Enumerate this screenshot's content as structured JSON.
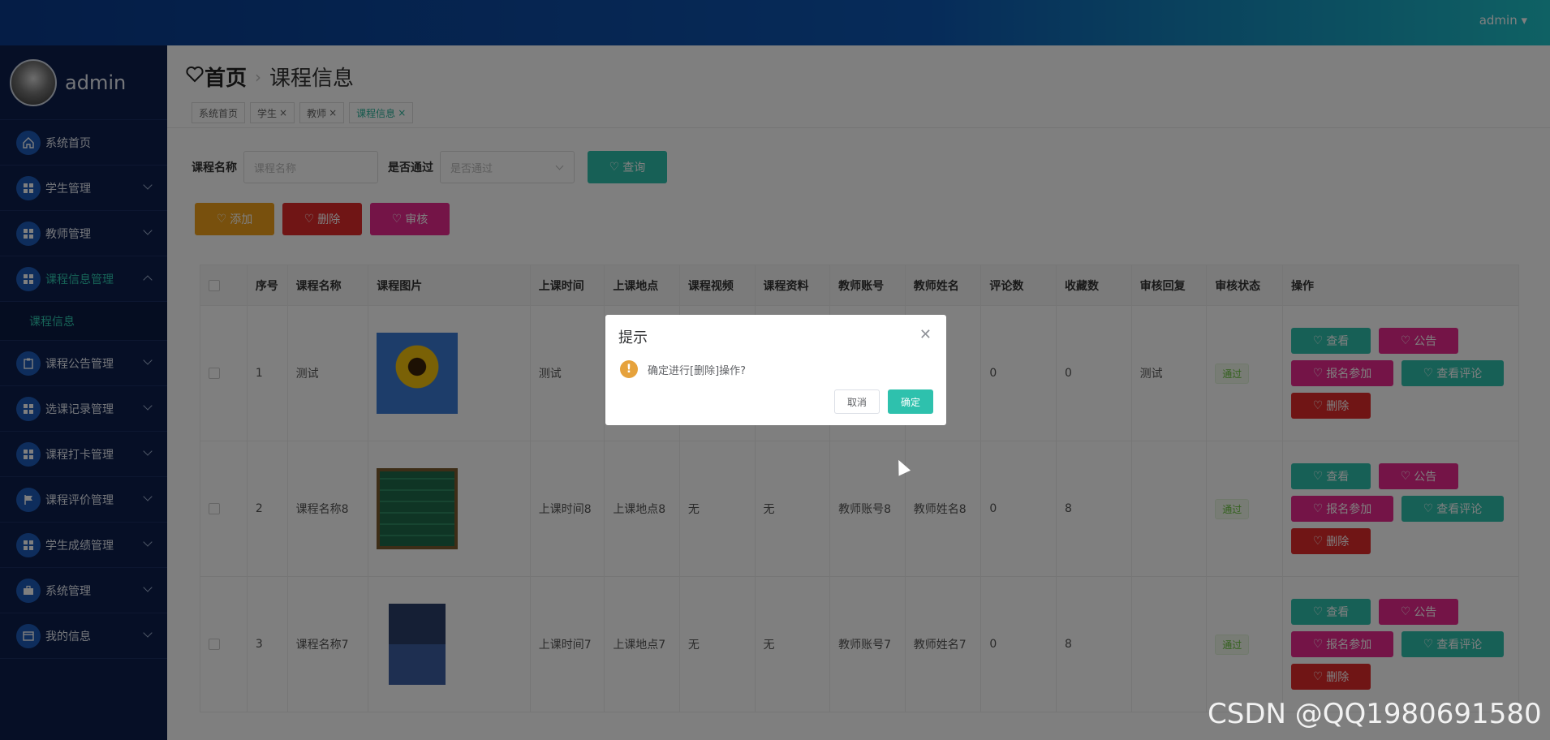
{
  "topbar": {
    "user": "admin ▾"
  },
  "sidebar": {
    "profile_name": "admin",
    "items": [
      {
        "label": "系统首页",
        "icon": "home-icon"
      },
      {
        "label": "学生管理",
        "icon": "grid-icon"
      },
      {
        "label": "教师管理",
        "icon": "grid-icon"
      },
      {
        "label": "课程信息管理",
        "icon": "grid-icon"
      },
      {
        "label": "课程公告管理",
        "icon": "clipboard-icon"
      },
      {
        "label": "选课记录管理",
        "icon": "grid-icon"
      },
      {
        "label": "课程打卡管理",
        "icon": "grid-icon"
      },
      {
        "label": "课程评价管理",
        "icon": "flag-icon"
      },
      {
        "label": "学生成绩管理",
        "icon": "grid-icon"
      },
      {
        "label": "系统管理",
        "icon": "briefcase-icon"
      },
      {
        "label": "我的信息",
        "icon": "card-icon"
      }
    ],
    "submenu": "课程信息"
  },
  "breadcrumb": {
    "home": "首页",
    "current": "课程信息"
  },
  "tabs": [
    {
      "label": "系统首页",
      "closable": false
    },
    {
      "label": "学生",
      "closable": true
    },
    {
      "label": "教师",
      "closable": true
    },
    {
      "label": "课程信息",
      "closable": true
    }
  ],
  "search": {
    "course_label": "课程名称",
    "course_placeholder": "课程名称",
    "pass_label": "是否通过",
    "pass_placeholder": "是否通过",
    "query_button": "查询"
  },
  "actions": {
    "add": "添加",
    "delete": "删除",
    "review": "审核"
  },
  "table": {
    "columns": [
      "序号",
      "课程名称",
      "课程图片",
      "上课时间",
      "上课地点",
      "课程视频",
      "课程资料",
      "教师账号",
      "教师姓名",
      "评论数",
      "收藏数",
      "审核回复",
      "审核状态",
      "操作"
    ],
    "rows": [
      {
        "no": "1",
        "name": "测试",
        "time": "测试",
        "place": "",
        "video": "",
        "material": "",
        "account": "",
        "teacher": "",
        "comments": "0",
        "favorites": "0",
        "reply": "测试",
        "status": "通过"
      },
      {
        "no": "2",
        "name": "课程名称8",
        "time": "上课时间8",
        "place": "上课地点8",
        "video": "无",
        "material": "无",
        "account": "教师账号8",
        "teacher": "教师姓名8",
        "comments": "0",
        "favorites": "8",
        "reply": "",
        "status": "通过"
      },
      {
        "no": "3",
        "name": "课程名称7",
        "time": "上课时间7",
        "place": "上课地点7",
        "video": "无",
        "material": "无",
        "account": "教师账号7",
        "teacher": "教师姓名7",
        "comments": "0",
        "favorites": "8",
        "reply": "",
        "status": "通过"
      }
    ],
    "op_labels": {
      "view": "查看",
      "notice": "公告",
      "enroll": "报名参加",
      "comments": "查看评论",
      "delete": "删除"
    }
  },
  "dialog": {
    "title": "提示",
    "message": "确定进行[删除]操作?",
    "cancel": "取消",
    "confirm": "确定"
  },
  "watermark": "CSDN @QQ1980691580"
}
